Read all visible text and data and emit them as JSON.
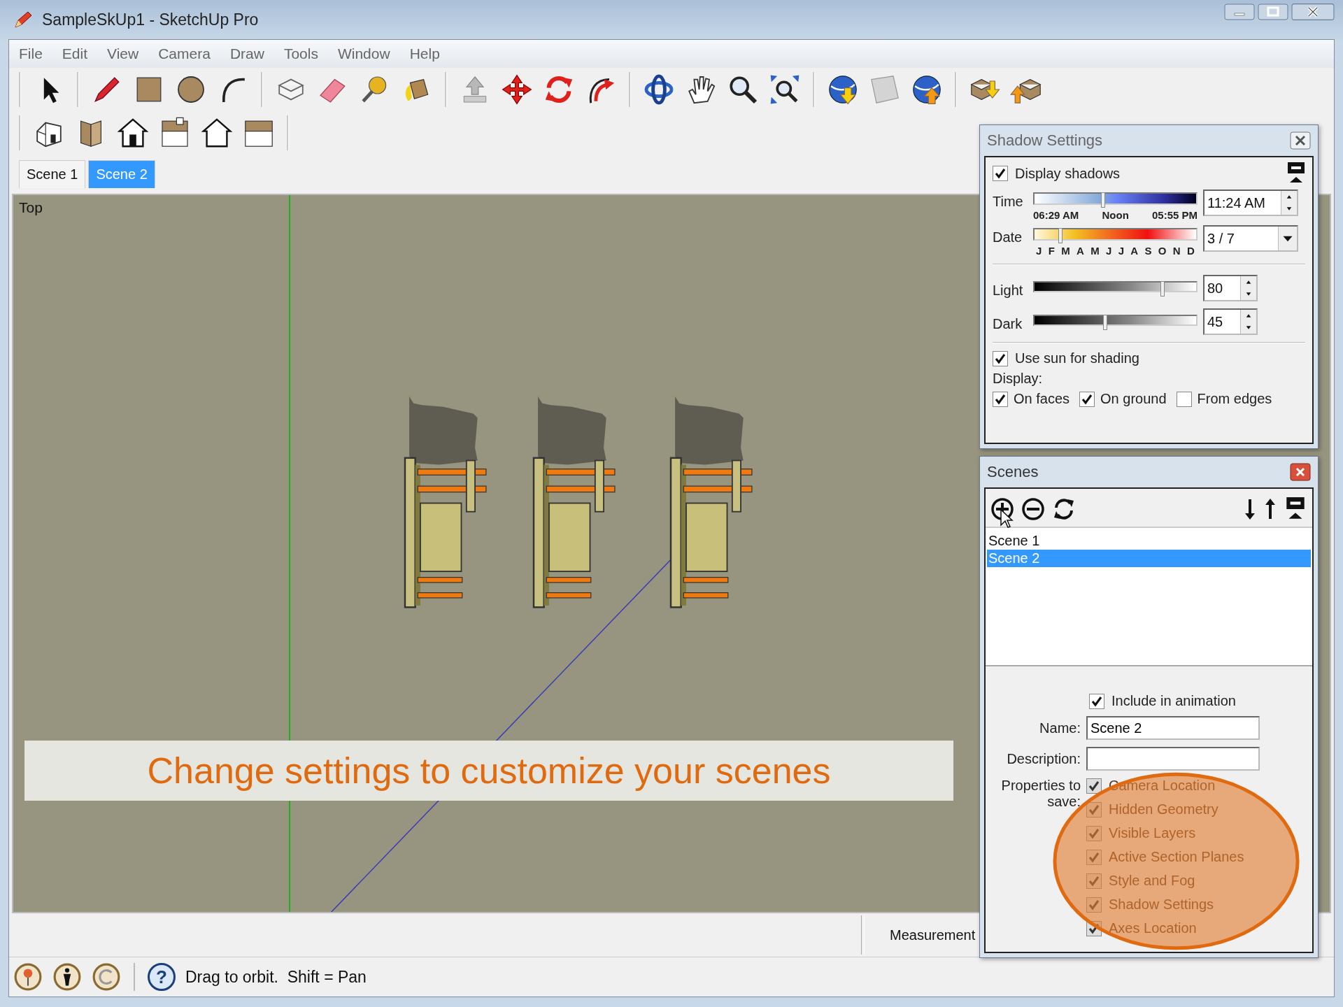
{
  "window": {
    "title": "SampleSkUp1 - SketchUp Pro"
  },
  "menu": [
    "File",
    "Edit",
    "View",
    "Camera",
    "Draw",
    "Tools",
    "Window",
    "Help"
  ],
  "scene_tabs": [
    {
      "label": "Scene 1",
      "selected": false
    },
    {
      "label": "Scene 2",
      "selected": true
    }
  ],
  "viewport": {
    "view_label": "Top",
    "caption": "Change settings to customize your scenes"
  },
  "measurements": {
    "label": "Measurement"
  },
  "status_bar": {
    "help_glyph": "?",
    "hint": "Drag to orbit.  Shift = Pan"
  },
  "shadow_settings": {
    "title": "Shadow Settings",
    "display_shadows": {
      "label": "Display shadows",
      "checked": true
    },
    "time": {
      "label": "Time",
      "level": 0.44,
      "marks": [
        "06:29 AM",
        "Noon",
        "05:55 PM"
      ],
      "value": "11:24 AM"
    },
    "date": {
      "label": "Date",
      "level": 0.18,
      "months": [
        "J",
        "F",
        "M",
        "A",
        "M",
        "J",
        "J",
        "A",
        "S",
        "O",
        "N",
        "D"
      ],
      "value": "3 / 7"
    },
    "light": {
      "label": "Light",
      "level": 0.8,
      "value": "80"
    },
    "dark": {
      "label": "Dark",
      "level": 0.45,
      "value": "45"
    },
    "use_sun": {
      "label": "Use sun for shading",
      "checked": true
    },
    "display_label": "Display:",
    "display_options": [
      {
        "label": "On faces",
        "checked": true
      },
      {
        "label": "On ground",
        "checked": true
      },
      {
        "label": "From edges",
        "checked": false
      }
    ]
  },
  "scenes_panel": {
    "title": "Scenes",
    "scenes": [
      {
        "name": "Scene 1",
        "selected": false
      },
      {
        "name": "Scene 2",
        "selected": true
      }
    ],
    "include_in_animation": {
      "label": "Include in animation",
      "checked": true
    },
    "name_field": {
      "label": "Name:",
      "value": "Scene 2"
    },
    "description_field": {
      "label": "Description:"
    },
    "properties_label": "Properties to save:",
    "properties": [
      {
        "label": "Camera Location",
        "checked": true
      },
      {
        "label": "Hidden Geometry",
        "checked": true
      },
      {
        "label": "Visible Layers",
        "checked": true
      },
      {
        "label": "Active Section Planes",
        "checked": true
      },
      {
        "label": "Style and Fog",
        "checked": true
      },
      {
        "label": "Shadow Settings",
        "checked": true
      },
      {
        "label": "Axes Location",
        "checked": true
      }
    ]
  }
}
